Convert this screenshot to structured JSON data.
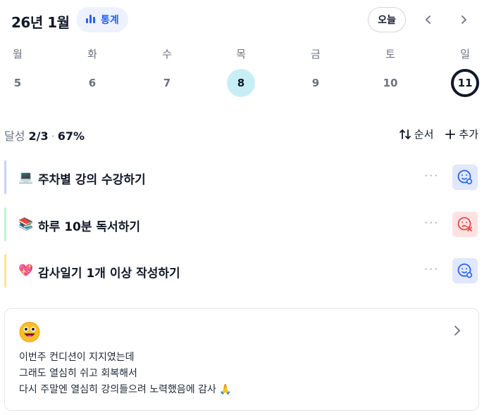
{
  "header": {
    "month": "26년 1월",
    "stats_label": "통계",
    "today_label": "오늘"
  },
  "week": {
    "days": [
      "월",
      "화",
      "수",
      "목",
      "금",
      "토",
      "일"
    ],
    "dates": [
      "5",
      "6",
      "7",
      "8",
      "9",
      "10",
      "11"
    ],
    "today_index": 3,
    "selected_index": 6
  },
  "summary": {
    "label": "달성",
    "done": "2/3",
    "percent": "67%",
    "sort_label": "순서",
    "add_label": "추가"
  },
  "tasks": [
    {
      "emoji": "💻",
      "title": "주차별 강의 수강하기",
      "bar_color": "#c7d2fe",
      "status": "done"
    },
    {
      "emoji": "📚",
      "title": "하루 10분 독서하기",
      "bar_color": "#bbf7d0",
      "status": "failed"
    },
    {
      "emoji": "💖",
      "title": "감사일기 1개 이상 작성하기",
      "bar_color": "#fde68a",
      "status": "done"
    }
  ],
  "more_label": "···",
  "note": {
    "emoji": "😜",
    "lines": [
      "이번주 컨디션이 지지였는데",
      "그래도 열심히 쉬고 회복해서",
      "다시 주말엔 열심히 강의들으려 노력했음에 감사 🙏"
    ]
  },
  "colors": {
    "accent": "#2563eb",
    "today_bg": "#c7eef5",
    "done_bg": "#e0e7ff",
    "failed_bg": "#fee2e2",
    "failed_fg": "#ef4444"
  }
}
